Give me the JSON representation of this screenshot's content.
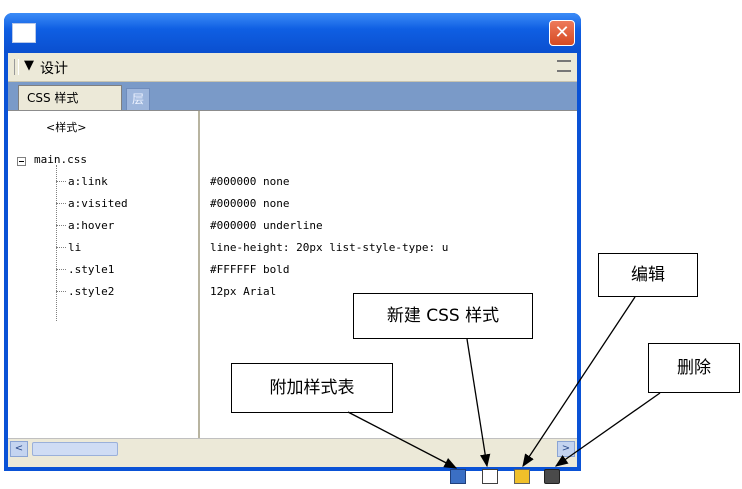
{
  "window": {
    "panel_title": "设计",
    "collapse_arrow": "▼",
    "close_glyph": "✕"
  },
  "tabs": {
    "active": "CSS 样式",
    "inactive": "层"
  },
  "tree": {
    "header": "<样式>",
    "file": "main.css",
    "expander": "⊟",
    "rules": [
      {
        "selector": "a:link",
        "value": "#000000 none"
      },
      {
        "selector": "a:visited",
        "value": "#000000 none"
      },
      {
        "selector": "a:hover",
        "value": "#000000 underline"
      },
      {
        "selector": "li",
        "value": "line-height: 20px list-style-type: u"
      },
      {
        "selector": ".style1",
        "value": "#FFFFFF bold"
      },
      {
        "selector": ".style2",
        "value": "12px Arial"
      }
    ]
  },
  "scrollbar": {
    "left": "<",
    "right": ">"
  },
  "toolbar": {
    "icons": [
      "attach-stylesheet-icon",
      "new-css-style-icon",
      "edit-style-icon",
      "delete-icon"
    ]
  },
  "callouts": {
    "attach": "附加样式表",
    "new_style": "新建 CSS 样式",
    "edit": "编辑",
    "delete": "删除"
  }
}
